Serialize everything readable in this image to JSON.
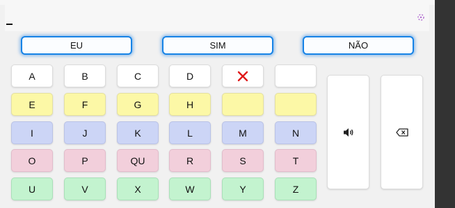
{
  "quick": [
    "EU",
    "SIM",
    "NÃO"
  ],
  "rows": [
    [
      "A",
      "B",
      "C",
      "D",
      "",
      ""
    ],
    [
      "E",
      "F",
      "G",
      "H",
      "",
      ""
    ],
    [
      "I",
      "J",
      "K",
      "L",
      "M",
      "N"
    ],
    [
      "O",
      "P",
      "QU",
      "R",
      "S",
      "T"
    ],
    [
      "U",
      "V",
      "X",
      "W",
      "Y",
      "Z"
    ]
  ],
  "icons": {
    "delete_key": "close-x-icon",
    "speak": "speaker-icon",
    "backspace": "backspace-icon",
    "corner": "resize-icon"
  }
}
